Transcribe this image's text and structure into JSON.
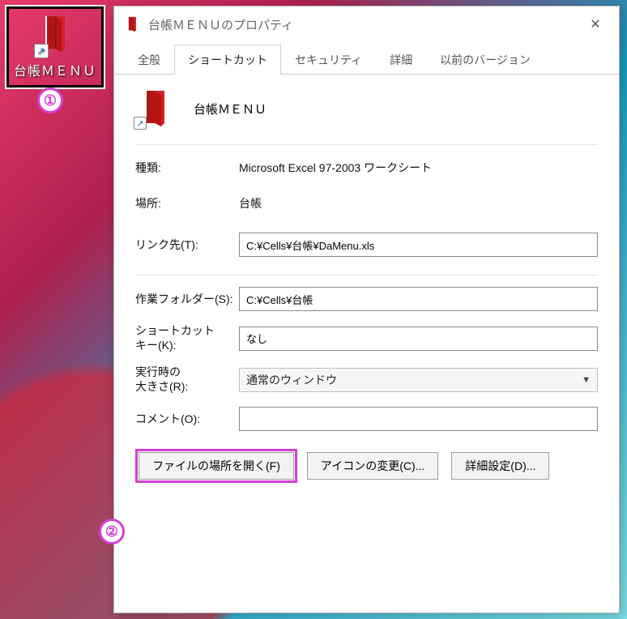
{
  "desktop_shortcut": {
    "label": "台帳ＭＥＮＵ"
  },
  "annotations": {
    "a1": "①",
    "a2": "②"
  },
  "dialog": {
    "title": "台帳ＭＥＮＵのプロパティ",
    "tabs": {
      "general": "全般",
      "shortcut": "ショートカット",
      "security": "セキュリティ",
      "details": "詳細",
      "previous": "以前のバージョン"
    },
    "header_name": "台帳ＭＥＮＵ",
    "fields": {
      "type_label": "種類:",
      "type_value": "Microsoft Excel 97-2003 ワークシート",
      "location_label": "場所:",
      "location_value": "台帳",
      "target_label": "リンク先(T):",
      "target_value": "C:¥Cells¥台帳¥DaMenu.xls",
      "workdir_label": "作業フォルダー(S):",
      "workdir_value": "C:¥Cells¥台帳",
      "shortcutkey_label": "ショートカット\nキー(K):",
      "shortcutkey_value": "なし",
      "run_label": "実行時の\n大きさ(R):",
      "run_value": "通常のウィンドウ",
      "comment_label": "コメント(O):",
      "comment_value": ""
    },
    "buttons": {
      "open_location": "ファイルの場所を開く(F)",
      "change_icon": "アイコンの変更(C)...",
      "advanced": "詳細設定(D)..."
    }
  }
}
